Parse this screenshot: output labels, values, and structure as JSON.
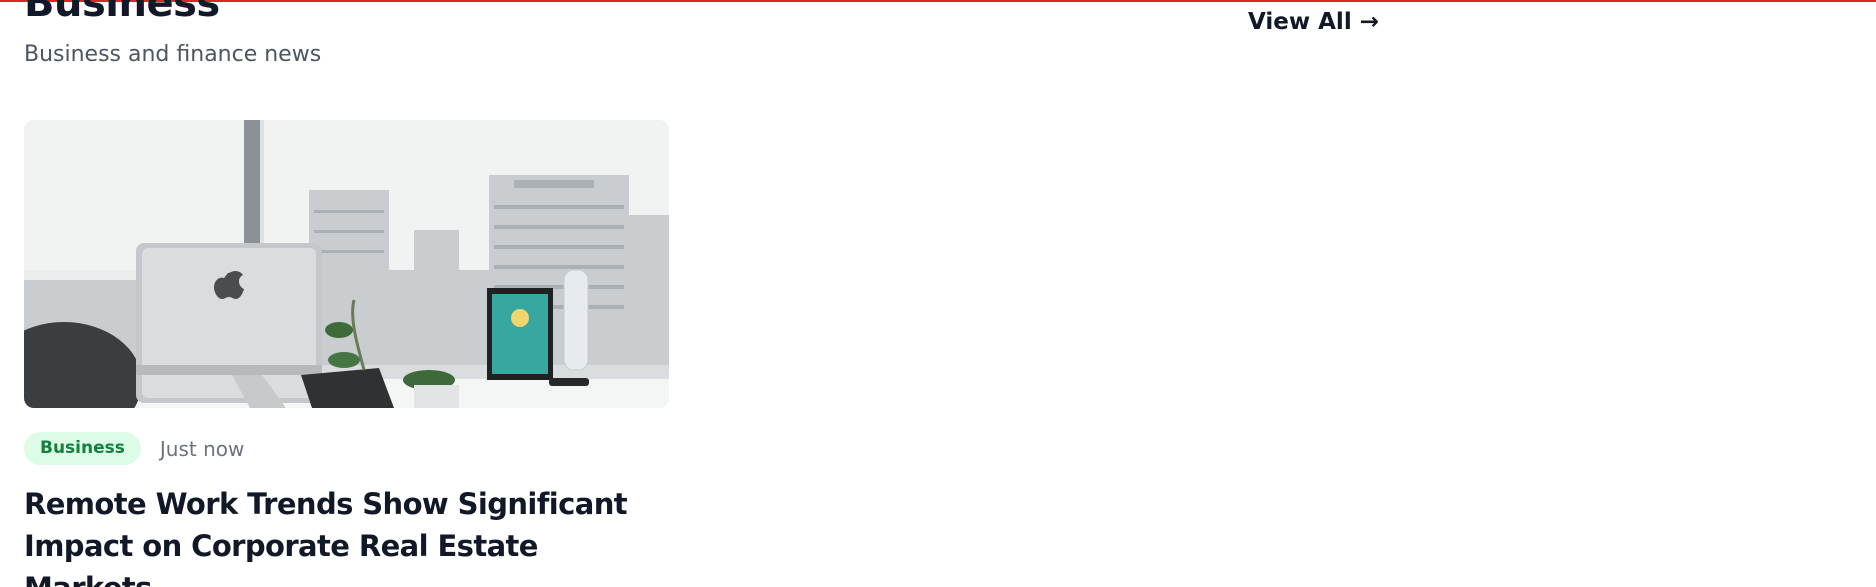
{
  "section": {
    "title": "Business",
    "subtitle": "Business and finance news",
    "view_all_label": "View All →"
  },
  "articles": [
    {
      "category": "Business",
      "time": "Just now",
      "title": "Remote Work Trends Show Significant Impact on Corporate Real Estate Markets"
    }
  ],
  "colors": {
    "accent": "#dc2626",
    "badge_bg": "#dcfce7",
    "badge_text": "#15803d"
  }
}
